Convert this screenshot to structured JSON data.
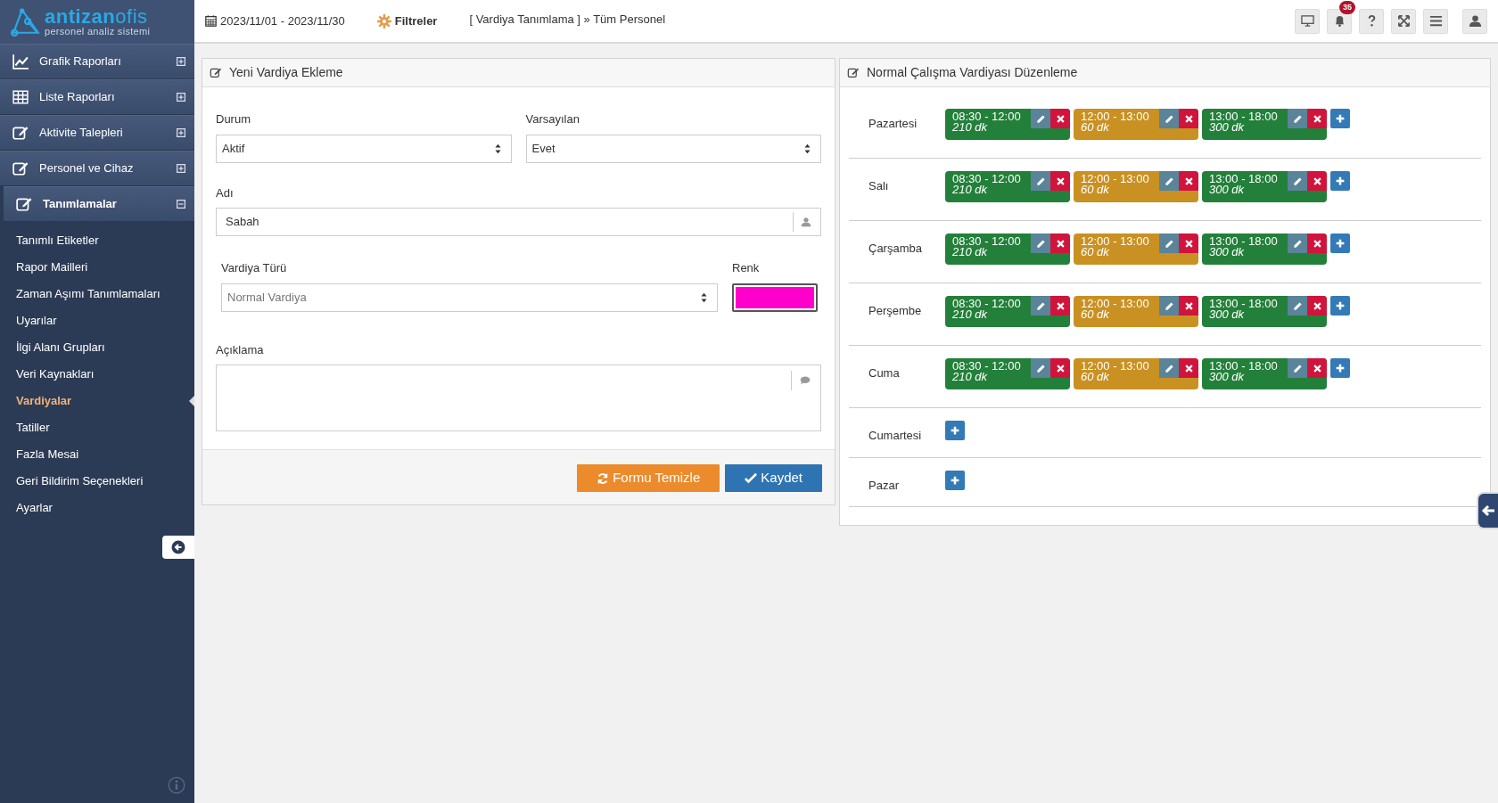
{
  "logo": {
    "brand_bold": "antizan",
    "brand_light": "ofis",
    "tagline": "personel analiz sistemi"
  },
  "sidebar": {
    "items": [
      {
        "label": "Grafik Raporları",
        "expanded": false
      },
      {
        "label": "Liste Raporları",
        "expanded": false
      },
      {
        "label": "Aktivite Talepleri",
        "expanded": false
      },
      {
        "label": "Personel ve Cihaz",
        "expanded": false
      },
      {
        "label": "Tanımlamalar",
        "expanded": true,
        "children": [
          {
            "label": "Tanımlı Etiketler",
            "selected": false
          },
          {
            "label": "Rapor Mailleri",
            "selected": false
          },
          {
            "label": "Zaman Aşımı Tanımlamaları",
            "selected": false
          },
          {
            "label": "Uyarılar",
            "selected": false
          },
          {
            "label": "İlgi Alanı Grupları",
            "selected": false
          },
          {
            "label": "Veri Kaynakları",
            "selected": false
          },
          {
            "label": "Vardiyalar",
            "selected": true
          },
          {
            "label": "Tatiller",
            "selected": false
          },
          {
            "label": "Fazla Mesai",
            "selected": false
          },
          {
            "label": "Geri Bildirim Seçenekleri",
            "selected": false
          },
          {
            "label": "Ayarlar",
            "selected": false
          }
        ]
      }
    ]
  },
  "header": {
    "date_range": "2023/11/01 - 2023/11/30",
    "filters": "Filtreler",
    "breadcrumb": "[ Vardiya Tanımlama ] » Tüm Personel",
    "notification_count": "35"
  },
  "form": {
    "title": "Yeni Vardiya Ekleme",
    "durum": {
      "label": "Durum",
      "value": "Aktif"
    },
    "varsayilan": {
      "label": "Varsayılan",
      "value": "Evet"
    },
    "adi": {
      "label": "Adı",
      "value": "Sabah"
    },
    "vardiya_turu": {
      "label": "Vardiya Türü",
      "value": "Normal Vardiya",
      "disabled": true
    },
    "renk": {
      "label": "Renk",
      "color": "#ff00cc"
    },
    "aciklama": {
      "label": "Açıklama"
    },
    "buttons": [
      {
        "label": "Formu Temizle",
        "kind": "reset"
      },
      {
        "label": "Kaydet",
        "kind": "save"
      }
    ]
  },
  "schedule": {
    "title": "Normal Çalışma Vardiyası Düzenleme",
    "days": [
      {
        "day": "Pazartesi",
        "shifts": [
          {
            "time": "08:30 - 12:00",
            "duration": "210 dk",
            "color": "#23803a"
          },
          {
            "time": "12:00 - 13:00",
            "duration": "60 dk",
            "color": "#c99122"
          },
          {
            "time": "13:00 - 18:00",
            "duration": "300 dk",
            "color": "#23803a"
          }
        ]
      },
      {
        "day": "Salı",
        "shifts": [
          {
            "time": "08:30 - 12:00",
            "duration": "210 dk",
            "color": "#23803a"
          },
          {
            "time": "12:00 - 13:00",
            "duration": "60 dk",
            "color": "#c99122"
          },
          {
            "time": "13:00 - 18:00",
            "duration": "300 dk",
            "color": "#23803a"
          }
        ]
      },
      {
        "day": "Çarşamba",
        "shifts": [
          {
            "time": "08:30 - 12:00",
            "duration": "210 dk",
            "color": "#23803a"
          },
          {
            "time": "12:00 - 13:00",
            "duration": "60 dk",
            "color": "#c99122"
          },
          {
            "time": "13:00 - 18:00",
            "duration": "300 dk",
            "color": "#23803a"
          }
        ]
      },
      {
        "day": "Perşembe",
        "shifts": [
          {
            "time": "08:30 - 12:00",
            "duration": "210 dk",
            "color": "#23803a"
          },
          {
            "time": "12:00 - 13:00",
            "duration": "60 dk",
            "color": "#c99122"
          },
          {
            "time": "13:00 - 18:00",
            "duration": "300 dk",
            "color": "#23803a"
          }
        ]
      },
      {
        "day": "Cuma",
        "shifts": [
          {
            "time": "08:30 - 12:00",
            "duration": "210 dk",
            "color": "#23803a"
          },
          {
            "time": "12:00 - 13:00",
            "duration": "60 dk",
            "color": "#c99122"
          },
          {
            "time": "13:00 - 18:00",
            "duration": "300 dk",
            "color": "#23803a"
          }
        ]
      },
      {
        "day": "Cumartesi"
      },
      {
        "day": "Pazar"
      }
    ]
  }
}
